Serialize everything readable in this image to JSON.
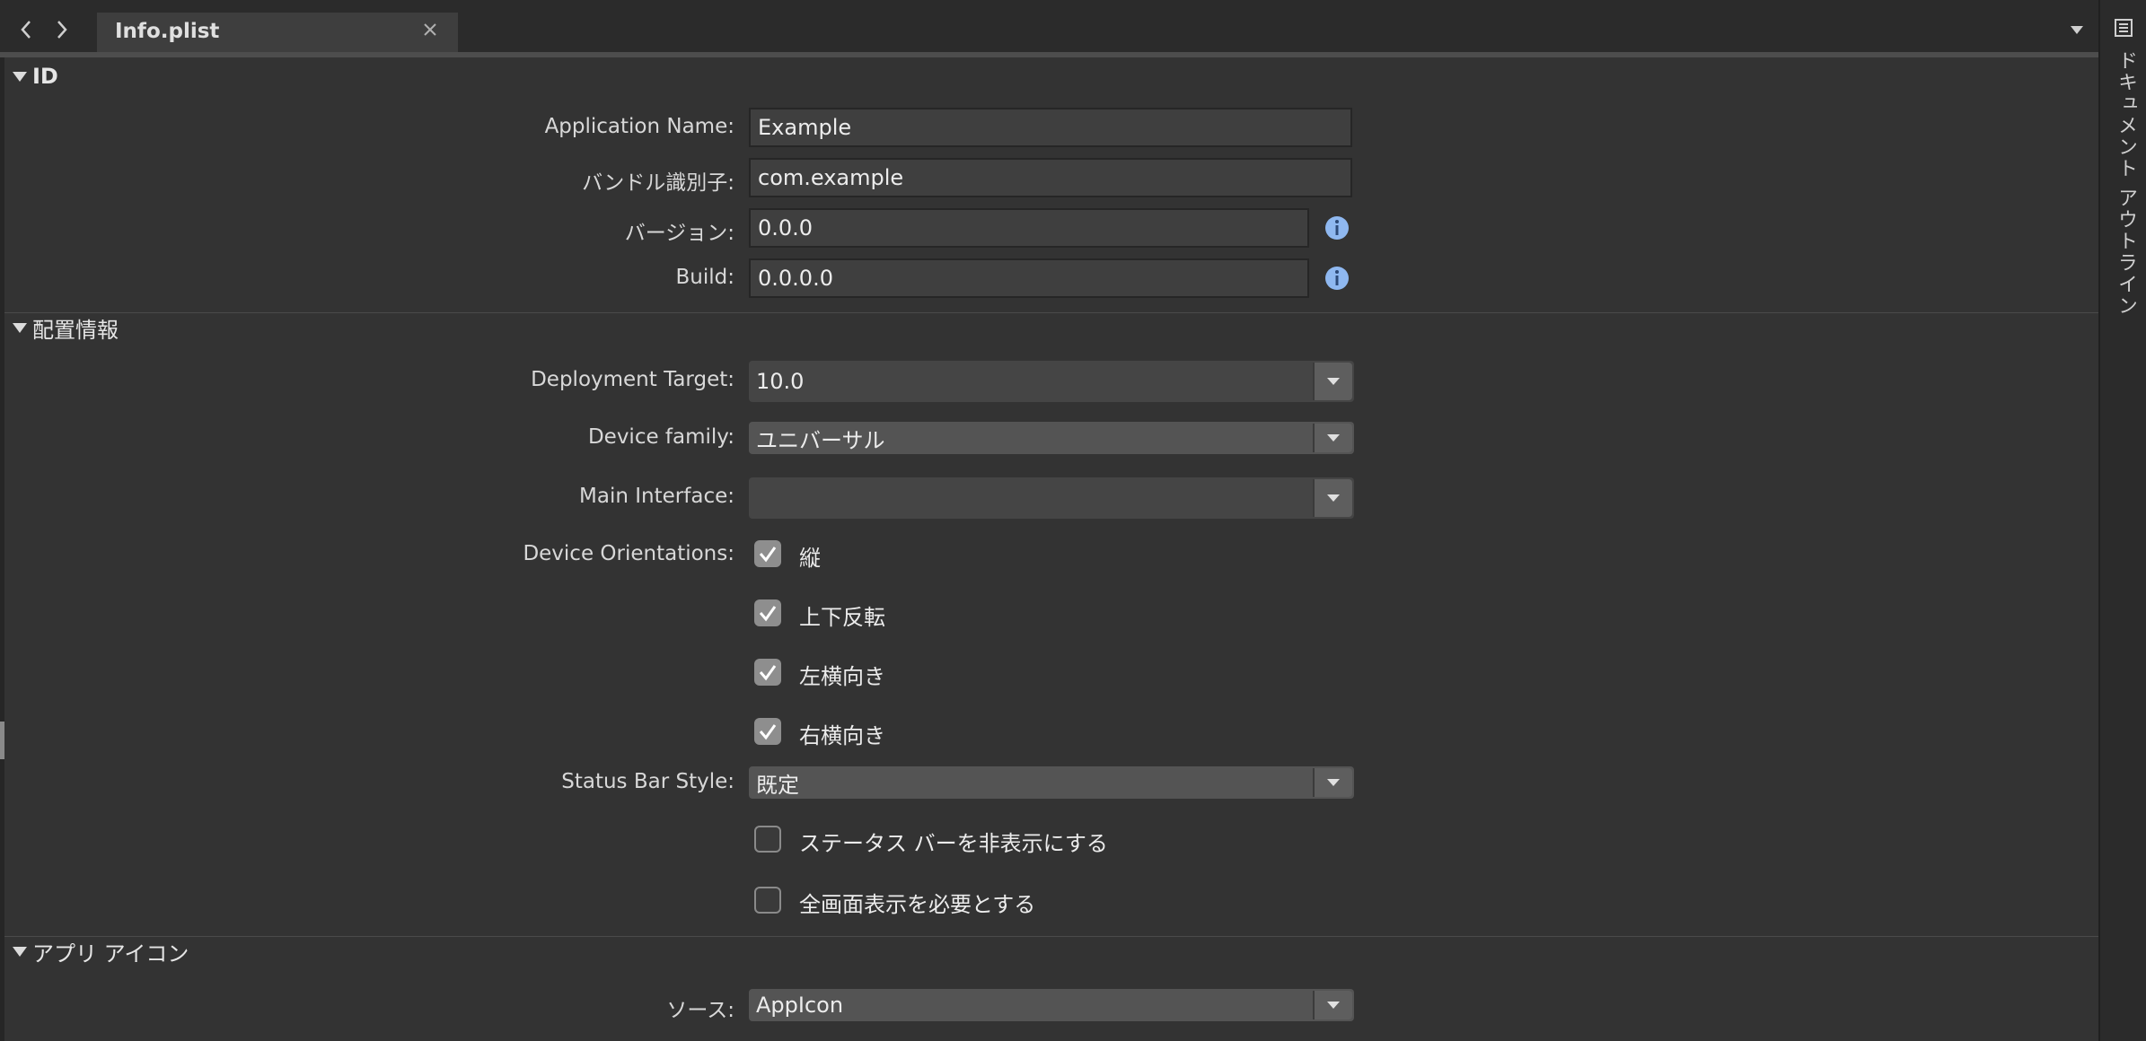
{
  "tab": {
    "title": "Info.plist"
  },
  "sidebar": {
    "title": "ドキュメント アウトライン"
  },
  "sections": {
    "id": "ID",
    "deploy": "配置情報",
    "icon": "アプリ アイコン"
  },
  "identity": {
    "app_name_label": "Application Name:",
    "app_name_value": "Example",
    "bundle_label": "バンドル識別子:",
    "bundle_value": "com.example",
    "version_label": "バージョン:",
    "version_value": "0.0.0",
    "build_label": "Build:",
    "build_value": "0.0.0.0"
  },
  "deployment": {
    "target_label": "Deployment Target:",
    "target_value": "10.0",
    "family_label": "Device family:",
    "family_value": "ユニバーサル",
    "main_label": "Main Interface:",
    "main_value": "",
    "orient_label": "Device Orientations:",
    "orientations": [
      {
        "label": "縦",
        "checked": true
      },
      {
        "label": "上下反転",
        "checked": true
      },
      {
        "label": "左横向き",
        "checked": true
      },
      {
        "label": "右横向き",
        "checked": true
      }
    ],
    "status_label": "Status Bar Style:",
    "status_value": "既定",
    "hide_status": {
      "label": "ステータス バーを非表示にする",
      "checked": false
    },
    "fullscreen": {
      "label": "全画面表示を必要とする",
      "checked": false
    }
  },
  "app_icon": {
    "source_label": "ソース:",
    "source_value": "AppIcon"
  },
  "colors": {
    "background": "#333333",
    "info_icon": "#8fb8f0",
    "tab_active": "#3e3e3e"
  }
}
